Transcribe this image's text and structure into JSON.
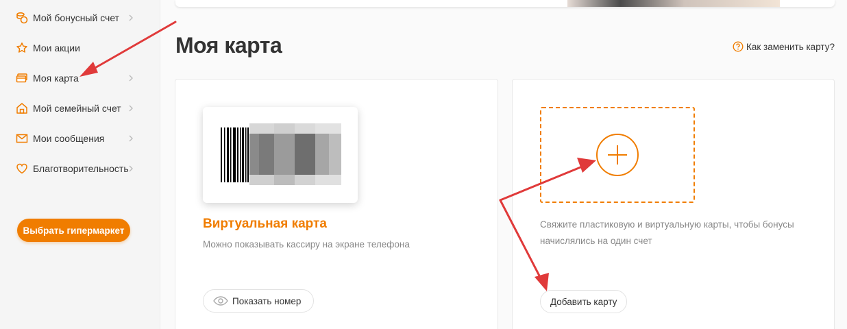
{
  "sidebar": {
    "items": [
      {
        "label": "Мой бонусный счет",
        "icon": "coins-icon"
      },
      {
        "label": "Мои акции",
        "icon": "star-icon"
      },
      {
        "label": "Моя карта",
        "icon": "card-icon"
      },
      {
        "label": "Мой семейный счет",
        "icon": "house-icon"
      },
      {
        "label": "Мои сообщения",
        "icon": "envelope-icon"
      },
      {
        "label": "Благотворительность",
        "icon": "heart-icon"
      }
    ],
    "cta_label": "Выбрать гипермаркет"
  },
  "main": {
    "title": "Моя карта",
    "help_link": "Как заменить карту?",
    "virtual_card": {
      "title": "Виртуальная карта",
      "description": "Можно показывать кассиру на экране телефона",
      "show_button": "Показать номер"
    },
    "add_card": {
      "description": "Свяжите пластиковую и виртуальную карты, чтобы бонусы начислялись на один счет",
      "button": "Добавить карту"
    }
  },
  "colors": {
    "accent": "#f07d00",
    "annotation_arrow": "#e03a3a"
  }
}
